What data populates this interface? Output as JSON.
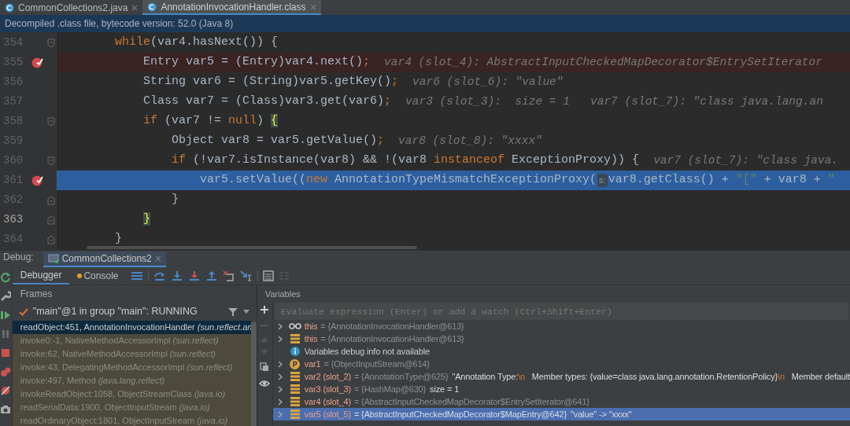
{
  "editor_tabs": [
    {
      "label": "CommonCollections2.java",
      "selected": false
    },
    {
      "label": "AnnotationInvocationHandler.class",
      "selected": true
    }
  ],
  "banner": "Decompiled .class file, bytecode version: 52.0 (Java 8)",
  "code_lines": [
    {
      "number": "354",
      "breakpoint": false,
      "execution_point": false,
      "current": false,
      "fold_start": true,
      "fold_end": false,
      "parts": [
        {
          "kind": "code",
          "tokens": [
            {
              "text": "while",
              "kind": "keyword"
            },
            {
              "text": "(var4.hasNext()) {",
              "kind": "plain"
            }
          ]
        }
      ],
      "children": [
        {
          "number": "355",
          "breakpoint": true,
          "execution_point": false,
          "current": false,
          "fold_start": false,
          "fold_end": false,
          "parts": [
            {
              "kind": "code",
              "tokens": [
                {
                  "text": "Entry var5 = (Entry)var4.next()",
                  "kind": "plain"
                },
                {
                  "text": ";",
                  "kind": "keyword"
                }
              ]
            },
            {
              "kind": "value-hint",
              "text": "var4 (slot_4): AbstractInputCheckedMapDecorator$EntrySetIterator"
            }
          ]
        },
        {
          "number": "356",
          "breakpoint": false,
          "execution_point": false,
          "current": false,
          "fold_start": false,
          "fold_end": false,
          "parts": [
            {
              "kind": "code",
              "tokens": [
                {
                  "text": "String var6 = (String)var5.getKey()",
                  "kind": "plain"
                },
                {
                  "text": ";",
                  "kind": "keyword"
                }
              ]
            },
            {
              "kind": "value-hint",
              "text": "var6 (slot_6): \"value\""
            }
          ]
        },
        {
          "number": "357",
          "breakpoint": false,
          "execution_point": false,
          "current": false,
          "fold_start": false,
          "fold_end": false,
          "parts": [
            {
              "kind": "code",
              "tokens": [
                {
                  "text": "Class var7 = (Class)var3.get(var6)",
                  "kind": "plain"
                },
                {
                  "text": ";",
                  "kind": "keyword"
                }
              ]
            },
            {
              "kind": "value-hint",
              "text": "var3 (slot_3):  size = 1   var7 (slot_7): \"class java.lang.an"
            }
          ]
        },
        {
          "number": "358",
          "breakpoint": false,
          "execution_point": false,
          "current": false,
          "fold_start": true,
          "fold_end": false,
          "parts": [
            {
              "kind": "code",
              "tokens": [
                {
                  "text": "if",
                  "kind": "keyword"
                },
                {
                  "text": " (var7 != ",
                  "kind": "plain"
                },
                {
                  "text": "null",
                  "kind": "keyword"
                },
                {
                  "text": ") ",
                  "kind": "plain"
                },
                {
                  "text": "{",
                  "kind": "brace-match"
                }
              ]
            }
          ],
          "children": [
            {
              "number": "359",
              "breakpoint": false,
              "execution_point": false,
              "current": false,
              "fold_start": false,
              "fold_end": false,
              "parts": [
                {
                  "kind": "code",
                  "tokens": [
                    {
                      "text": "Object var8 = var5.getValue()",
                      "kind": "plain"
                    },
                    {
                      "text": ";",
                      "kind": "keyword"
                    }
                  ]
                },
                {
                  "kind": "value-hint",
                  "text": "var8 (slot_8): \"xxxx\""
                }
              ]
            },
            {
              "number": "360",
              "breakpoint": false,
              "execution_point": false,
              "current": false,
              "fold_start": true,
              "fold_end": false,
              "parts": [
                {
                  "kind": "code",
                  "tokens": [
                    {
                      "text": "if",
                      "kind": "keyword"
                    },
                    {
                      "text": " (!var7.isInstance(var8) && !(var8 ",
                      "kind": "plain"
                    },
                    {
                      "text": "instanceof",
                      "kind": "keyword"
                    },
                    {
                      "text": " ExceptionProxy)) {",
                      "kind": "plain"
                    }
                  ]
                },
                {
                  "kind": "value-hint",
                  "text": "var7 (slot_7): \"class java."
                }
              ],
              "children": [
                {
                  "number": "361",
                  "breakpoint": true,
                  "execution_point": true,
                  "current": false,
                  "fold_start": false,
                  "fold_end": false,
                  "parts": [
                    {
                      "kind": "code",
                      "tokens": [
                        {
                          "text": "var5.setValue((",
                          "kind": "plain"
                        },
                        {
                          "text": "new",
                          "kind": "keyword"
                        },
                        {
                          "text": " AnnotationTypeMismatchExceptionProxy(",
                          "kind": "plain"
                        }
                      ]
                    },
                    {
                      "kind": "param-hint",
                      "text": "s:"
                    },
                    {
                      "kind": "code",
                      "tokens": [
                        {
                          "text": "var8.getClass() + ",
                          "kind": "plain"
                        },
                        {
                          "text": "\"[\"",
                          "kind": "string"
                        },
                        {
                          "text": " + var8 + ",
                          "kind": "plain"
                        },
                        {
                          "text": "\"",
                          "kind": "string"
                        }
                      ]
                    }
                  ]
                }
              ]
            },
            {
              "number": "362",
              "breakpoint": false,
              "execution_point": false,
              "current": false,
              "fold_start": false,
              "fold_end": true,
              "parts": [
                {
                  "kind": "code",
                  "tokens": [
                    {
                      "text": "}",
                      "kind": "plain"
                    }
                  ]
                }
              ]
            }
          ]
        },
        {
          "number": "363",
          "breakpoint": false,
          "execution_point": false,
          "current": true,
          "fold_start": false,
          "fold_end": true,
          "parts": [
            {
              "kind": "code",
              "tokens": [
                {
                  "text": "}",
                  "kind": "brace-match"
                }
              ]
            }
          ]
        }
      ]
    },
    {
      "number": "364",
      "breakpoint": false,
      "execution_point": false,
      "current": false,
      "fold_start": false,
      "fold_end": true,
      "parts": [
        {
          "kind": "code",
          "tokens": [
            {
              "text": "}",
              "kind": "plain"
            }
          ]
        }
      ]
    }
  ],
  "debug": {
    "label": "Debug:",
    "session_tab": "CommonCollections2",
    "subtabs": [
      {
        "label": "Debugger",
        "selected": true
      },
      {
        "label": "Console",
        "selected": false
      }
    ],
    "frames": {
      "title": "Frames",
      "thread": "\"main\"@1 in group \"main\": RUNNING",
      "items": [
        {
          "method": "readObject:451, AnnotationInvocationHandler",
          "package": "(sun.reflect.an",
          "selected": true,
          "library": false
        },
        {
          "method": "invoke0:-1, NativeMethodAccessorImpl",
          "package": "(sun.reflect)",
          "selected": false,
          "library": true
        },
        {
          "method": "invoke:62, NativeMethodAccessorImpl",
          "package": "(sun.reflect)",
          "selected": false,
          "library": true
        },
        {
          "method": "invoke:43, DelegatingMethodAccessorImpl",
          "package": "(sun.reflect)",
          "selected": false,
          "library": true
        },
        {
          "method": "invoke:497, Method",
          "package": "(java.lang.reflect)",
          "selected": false,
          "library": true
        },
        {
          "method": "invokeReadObject:1058, ObjectStreamClass",
          "package": "(java.io)",
          "selected": false,
          "library": true
        },
        {
          "method": "readSerialData:1900, ObjectInputStream",
          "package": "(java.io)",
          "selected": false,
          "library": true
        },
        {
          "method": "readOrdinaryObject:1801, ObjectInputStream",
          "package": "(java.io)",
          "selected": false,
          "library": true
        }
      ]
    },
    "variables": {
      "title": "Variables",
      "placeholder": "Evaluate expression (Enter) or add a watch (Ctrl+Shift+Enter)",
      "items": [
        {
          "kind": "watch",
          "name": "this",
          "value": "= {AnnotationInvocationHandler@613}",
          "selected": false
        },
        {
          "kind": "field",
          "name": "this",
          "value": "= {AnnotationInvocationHandler@613}",
          "selected": false
        },
        {
          "kind": "info",
          "name": "Variables debug info not available",
          "selected": false
        },
        {
          "kind": "param",
          "name": "var1",
          "value": "= {ObjectInputStream@614}",
          "selected": false
        },
        {
          "kind": "field",
          "name": "var2 (slot_2)",
          "value": "= {AnnotationType@625}",
          "detail": [
            {
              "text": "\"Annotation Type:",
              "kind": "plain"
            },
            {
              "text": "\\n",
              "kind": "escape"
            },
            {
              "text": "   Member types: {value=class java.lang.annotation.RetentionPolicy}",
              "kind": "plain"
            },
            {
              "text": "\\n",
              "kind": "escape"
            },
            {
              "text": "   Member default",
              "kind": "plain"
            }
          ],
          "selected": false
        },
        {
          "kind": "field",
          "name": "var3 (slot_3)",
          "value": "= {HashMap@630}",
          "detail": [
            {
              "text": "size = 1",
              "kind": "plain"
            }
          ],
          "selected": false
        },
        {
          "kind": "field",
          "name": "var4 (slot_4)",
          "value": "= {AbstractInputCheckedMapDecorator$EntrySetIterator@641}",
          "selected": false
        },
        {
          "kind": "field",
          "name": "var5 (slot_5)",
          "value": "= {AbstractInputCheckedMapDecorator$MapEntry@642}",
          "detail": [
            {
              "text": "\"value\" -> \"xxxx\"",
              "kind": "plain"
            }
          ],
          "selected": true
        }
      ]
    }
  }
}
